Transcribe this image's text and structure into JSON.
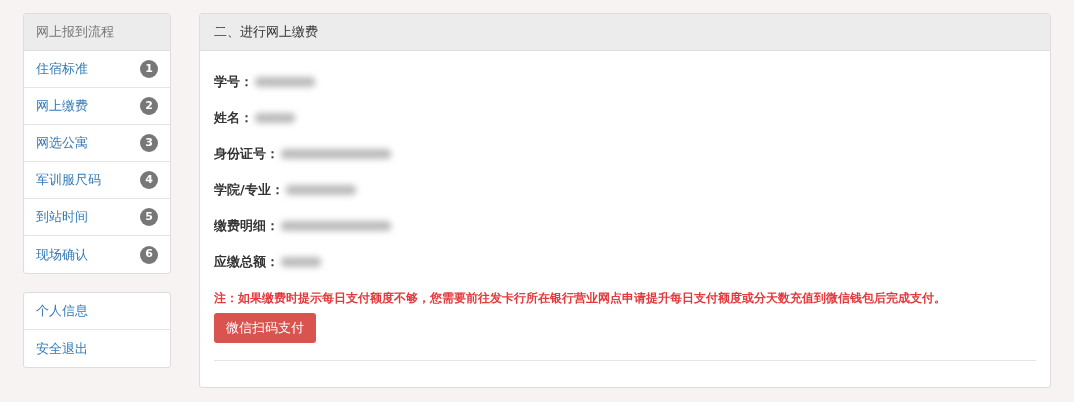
{
  "sidebar": {
    "title": "网上报到流程",
    "items": [
      {
        "label": "住宿标准",
        "badge": "1"
      },
      {
        "label": "网上缴费",
        "badge": "2"
      },
      {
        "label": "网选公寓",
        "badge": "3"
      },
      {
        "label": "军训服尺码",
        "badge": "4"
      },
      {
        "label": "到站时间",
        "badge": "5"
      },
      {
        "label": "现场确认",
        "badge": "6"
      }
    ]
  },
  "account_menu": {
    "items": [
      {
        "label": "个人信息"
      },
      {
        "label": "安全退出"
      }
    ]
  },
  "panel": {
    "title": "二、进行网上缴费",
    "fields": [
      {
        "label": "学号："
      },
      {
        "label": "姓名："
      },
      {
        "label": "身份证号："
      },
      {
        "label": "学院/专业："
      },
      {
        "label": "缴费明细："
      },
      {
        "label": "应缴总额："
      }
    ],
    "note": "注：如果缴费时提示每日支付额度不够，您需要前往发卡行所在银行营业网点申请提升每日支付额度或分天数充值到微信钱包后完成支付。",
    "pay_button": "微信扫码支付"
  }
}
